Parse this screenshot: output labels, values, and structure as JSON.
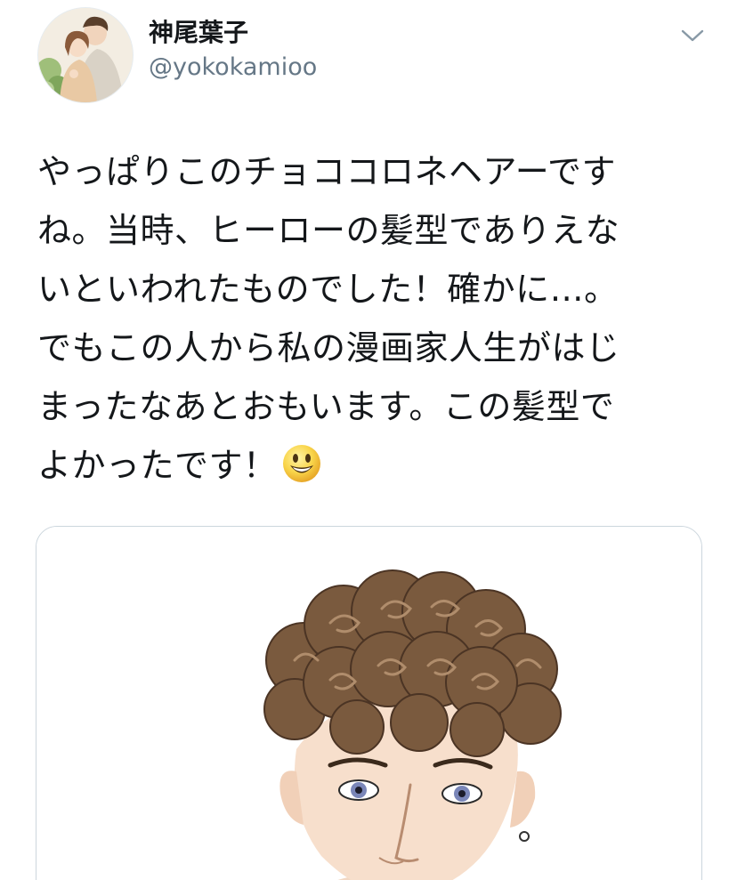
{
  "tweet": {
    "author": {
      "display_name": "神尾葉子",
      "handle": "@yokokamioo",
      "avatar_icon": "profile-photo-icon"
    },
    "menu_icon": "chevron-down-icon",
    "text_lines": [
      "やっぱりこのチョココロネヘアーです",
      "ね。当時、ヒーローの髪型でありえな",
      "いといわれたものでした！確かに…。",
      "でもこの人から私の漫画家人生がはじ",
      "まったなあとおもいます。この髪型で",
      "よかったです！"
    ],
    "emoji": "smiley-face-emoji",
    "media": {
      "type": "illustration",
      "description_icon": "manga-character-illustration"
    }
  },
  "colors": {
    "text_primary": "#14171a",
    "text_secondary": "#657786",
    "border": "#ccd6dd",
    "hair": "#7a5a3e",
    "hair_dark": "#4b3424",
    "skin": "#f6dcc6"
  }
}
